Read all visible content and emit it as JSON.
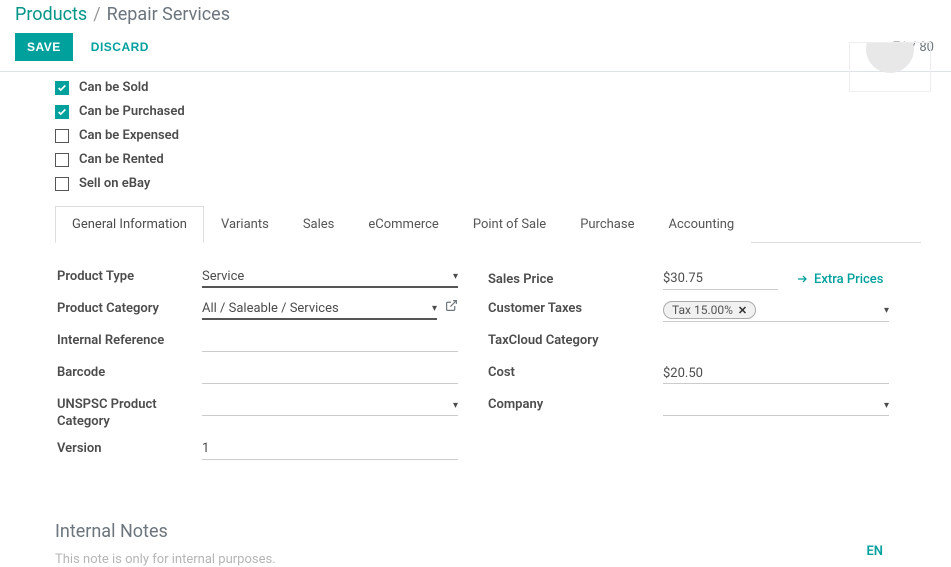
{
  "breadcrumb": {
    "root": "Products",
    "current": "Repair Services"
  },
  "toolbar": {
    "save": "SAVE",
    "discard": "DISCARD"
  },
  "pager": {
    "text": "71 / 80"
  },
  "checkboxes": [
    {
      "label": "Can be Sold",
      "checked": true
    },
    {
      "label": "Can be Purchased",
      "checked": true
    },
    {
      "label": "Can be Expensed",
      "checked": false
    },
    {
      "label": "Can be Rented",
      "checked": false
    },
    {
      "label": "Sell on eBay",
      "checked": false
    }
  ],
  "tabs": [
    {
      "label": "General Information",
      "active": true
    },
    {
      "label": "Variants",
      "active": false
    },
    {
      "label": "Sales",
      "active": false
    },
    {
      "label": "eCommerce",
      "active": false
    },
    {
      "label": "Point of Sale",
      "active": false
    },
    {
      "label": "Purchase",
      "active": false
    },
    {
      "label": "Accounting",
      "active": false
    }
  ],
  "left_fields": {
    "product_type": {
      "label": "Product Type",
      "value": "Service"
    },
    "product_category": {
      "label": "Product Category",
      "value": "All / Saleable / Services"
    },
    "internal_reference": {
      "label": "Internal Reference",
      "value": ""
    },
    "barcode": {
      "label": "Barcode",
      "value": ""
    },
    "unspsc": {
      "label": "UNSPSC Product Category",
      "value": ""
    },
    "version": {
      "label": "Version",
      "value": "1"
    }
  },
  "right_fields": {
    "sales_price": {
      "label": "Sales Price",
      "value": "$30.75",
      "extra": "Extra Prices"
    },
    "customer_taxes": {
      "label": "Customer Taxes",
      "tag": "Tax 15.00%"
    },
    "taxcloud": {
      "label": "TaxCloud Category",
      "value": ""
    },
    "cost": {
      "label": "Cost",
      "value": "$20.50"
    },
    "company": {
      "label": "Company",
      "value": ""
    }
  },
  "internal_notes": {
    "heading": "Internal Notes",
    "placeholder": "This note is only for internal purposes."
  },
  "lang": "EN"
}
